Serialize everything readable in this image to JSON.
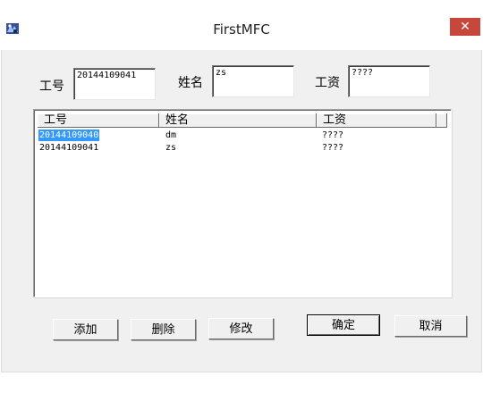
{
  "window": {
    "title": "FirstMFC",
    "close_glyph": "✕"
  },
  "form": {
    "id_label": "工号",
    "id_value": "20144109041",
    "name_label": "姓名",
    "name_value": "zs",
    "salary_label": "工资",
    "salary_value": "????"
  },
  "list": {
    "columns": [
      "工号",
      "姓名",
      "工资"
    ],
    "rows": [
      {
        "id": "20144109040",
        "name": "dm",
        "salary": "????",
        "selected": true
      },
      {
        "id": "20144109041",
        "name": "zs",
        "salary": "????",
        "selected": false
      }
    ]
  },
  "buttons": {
    "add": "添加",
    "delete": "删除",
    "modify": "修改",
    "ok": "确定",
    "cancel": "取消"
  },
  "icons": {
    "app": "mfc-app-icon",
    "close": "close-icon"
  },
  "colors": {
    "selection": "#3399ff",
    "close_button": "#c7473a",
    "dialog_bg": "#f0f0f0"
  }
}
